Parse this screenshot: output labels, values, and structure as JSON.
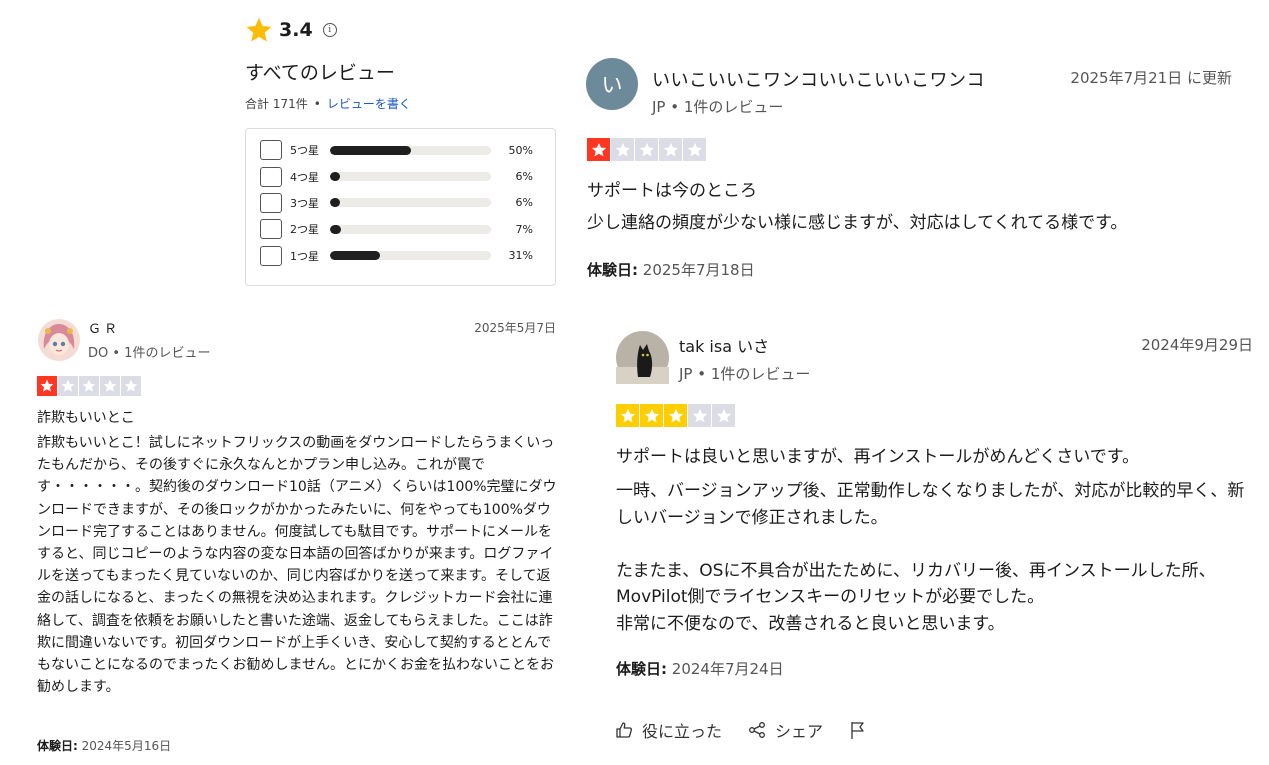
{
  "summary": {
    "rating": "3.4",
    "title": "すべてのレビュー",
    "total": "合計 171件",
    "separator": "•",
    "write_review": "レビューを書く",
    "distribution": [
      {
        "label": "5つ星",
        "percent_text": "50%",
        "fraction": 0.5
      },
      {
        "label": "4つ星",
        "percent_text": "6%",
        "fraction": 0.06
      },
      {
        "label": "3つ星",
        "percent_text": "6%",
        "fraction": 0.06
      },
      {
        "label": "2つ星",
        "percent_text": "7%",
        "fraction": 0.07
      },
      {
        "label": "1つ星",
        "percent_text": "31%",
        "fraction": 0.31
      }
    ]
  },
  "colors": {
    "star_red": "#ff3722",
    "star_yellow": "#ffce00",
    "star_empty": "#dcdce6",
    "avatar_bg": "#6d8a9b"
  },
  "reviews": [
    {
      "avatar_letter": "い",
      "name": "いいこいいこワンコいいこいいこワンコ",
      "date": "2025年7月21日 に更新",
      "meta": "JP • 1件のレビュー",
      "stars": 1,
      "title": "サポートは今のところ",
      "body": "少し連絡の頻度が少ない様に感じますが、対応はしてくれてる様です。",
      "experience_label": "体験日:",
      "experience_date": "2025年7月18日"
    },
    {
      "avatar_icon": "anime-character-avatar",
      "name": "ＧＲ",
      "date": "2025年5月7日",
      "meta": "DO • 1件のレビュー",
      "stars": 1,
      "title": "詐欺もいいとこ",
      "body": "詐欺もいいとこ！試しにネットフリックスの動画をダウンロードしたらうまくいったもんだから、その後すぐに永久なんとかプラン申し込み。これが罠です・・・・・・。契約後のダウンロード10話（アニメ）くらいは100%完璧にダウンロードできますが、その後ロックがかかったみたいに、何をやっても100%ダウンロード完了することはありません。何度試しても駄目です。サポートにメールをすると、同じコピーのような内容の変な日本語の回答ばかりが来ます。ログファイルを送ってもまったく見ていないのか、同じ内容ばかりを送って来ます。そして返金の話しになると、まったくの無視を決め込まれます。クレジットカード会社に連絡して、調査を依頼をお願いしたと書いた途端、返金してもらえました。ここは詐欺に間違いないです。初回ダウンロードが上手くいき、安心して契約するととんでもないことになるのでまったくお勧めしません。とにかくお金を払わないことをお勧めします。",
      "experience_label": "体験日:",
      "experience_date": "2024年5月16日"
    },
    {
      "avatar_icon": "black-cat-avatar",
      "name": "tak isa いさ",
      "date": "2024年9月29日",
      "meta": "JP • 1件のレビュー",
      "stars": 3,
      "title": "サポートは良いと思いますが、再インストールがめんどくさいです。",
      "body": "一時、バージョンアップ後、正常動作しなくなりましたが、対応が比較的早く、新しいバージョンで修正されました。\n\nたまたま、OSに不具合が出たために、リカバリー後、再インストールした所、MovPilot側でライセンスキーのリセットが必要でした。\n非常に不便なので、改善されると良いと思います。",
      "experience_label": "体験日:",
      "experience_date": "2024年7月24日",
      "actions": {
        "helpful": "役に立った",
        "share": "シェア"
      }
    }
  ]
}
